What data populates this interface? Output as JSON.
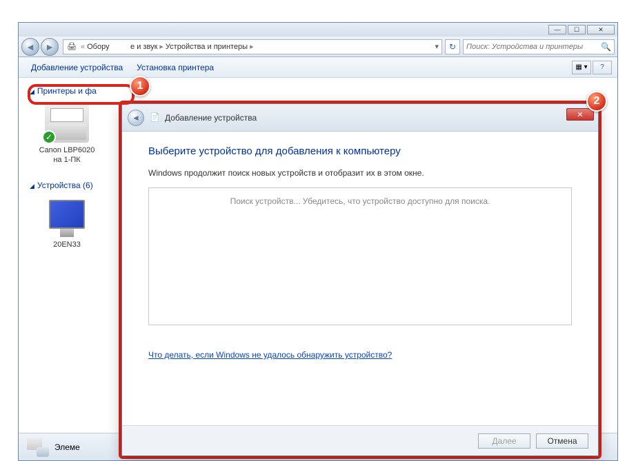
{
  "breadcrumb": {
    "part1": "Обору",
    "part2": "е и звук",
    "part3": "Устройства и принтеры"
  },
  "search": {
    "placeholder": "Поиск: Устройства и принтеры"
  },
  "toolbar": {
    "add_device": "Добавление устройства",
    "install_printer": "Установка принтера"
  },
  "groups": {
    "printers": {
      "label": "Принтеры и фа"
    },
    "devices": {
      "label": "Устройства (6)"
    }
  },
  "items": {
    "printer1": {
      "line1": "Canon LBP6020",
      "line2": "на 1-ПК"
    },
    "device1": {
      "label": "20EN33"
    }
  },
  "statusbar": {
    "text": "Элеме"
  },
  "dialog": {
    "title": "Добавление устройства",
    "heading": "Выберите устройство для добавления к компьютеру",
    "body_text": "Windows продолжит поиск новых устройств и отобразит их в этом окне.",
    "searching": "Поиск устройств... Убедитесь, что устройство доступно для поиска.",
    "help_link": "Что делать, если Windows не удалось обнаружить устройство?",
    "next": "Далее",
    "cancel": "Отмена"
  },
  "annotations": {
    "one": "1",
    "two": "2"
  }
}
